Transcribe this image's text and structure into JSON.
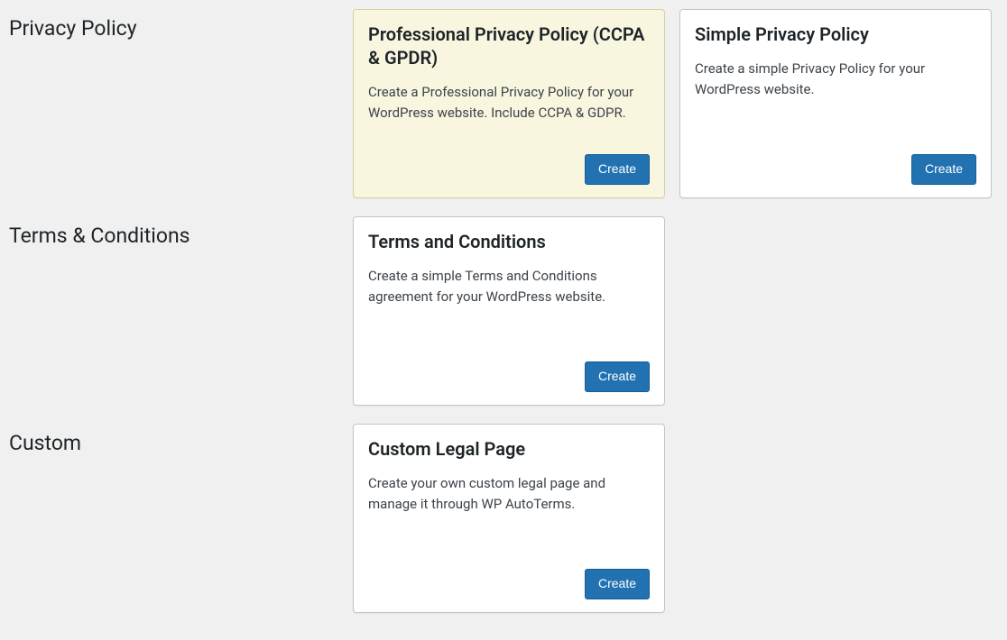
{
  "sections": {
    "privacy": {
      "label": "Privacy Policy",
      "cards": {
        "professional": {
          "title": "Professional Privacy Policy (CCPA & GPDR)",
          "description": "Create a Professional Privacy Policy for your WordPress website. Include CCPA & GDPR.",
          "button": "Create"
        },
        "simple": {
          "title": "Simple Privacy Policy",
          "description": "Create a simple Privacy Policy for your WordPress website.",
          "button": "Create"
        }
      }
    },
    "terms": {
      "label": "Terms & Conditions",
      "cards": {
        "terms": {
          "title": "Terms and Conditions",
          "description": "Create a simple Terms and Conditions agreement for your WordPress website.",
          "button": "Create"
        }
      }
    },
    "custom": {
      "label": "Custom",
      "cards": {
        "custom": {
          "title": "Custom Legal Page",
          "description": "Create your own custom legal page and manage it through WP AutoTerms.",
          "button": "Create"
        }
      }
    }
  }
}
